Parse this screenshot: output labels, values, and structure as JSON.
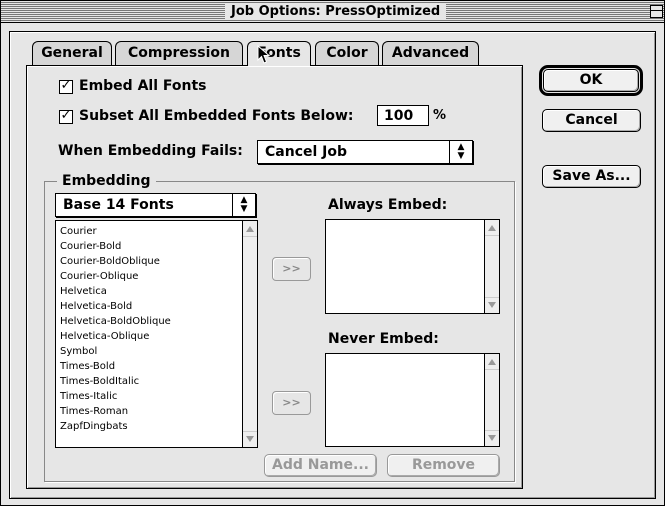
{
  "window": {
    "title": "Job Options: PressOptimized"
  },
  "tabs": [
    {
      "label": "General"
    },
    {
      "label": "Compression"
    },
    {
      "label": "Fonts"
    },
    {
      "label": "Color"
    },
    {
      "label": "Advanced"
    }
  ],
  "fonts_panel": {
    "embed_all": {
      "label": "Embed All Fonts",
      "checked": true
    },
    "subset": {
      "label": "Subset All Embedded Fonts Below:",
      "checked": true,
      "value": "100",
      "unit": "%"
    },
    "when_fails": {
      "label": "When Embedding Fails:",
      "selected": "Cancel Job"
    },
    "embedding": {
      "title": "Embedding",
      "source_selected": "Base 14 Fonts",
      "font_list": [
        "Courier",
        "Courier-Bold",
        "Courier-BoldOblique",
        "Courier-Oblique",
        "Helvetica",
        "Helvetica-Bold",
        "Helvetica-BoldOblique",
        "Helvetica-Oblique",
        "Symbol",
        "Times-Bold",
        "Times-BoldItalic",
        "Times-Italic",
        "Times-Roman",
        "ZapfDingbats"
      ],
      "move_button_label": ">>",
      "always_embed_label": "Always Embed:",
      "never_embed_label": "Never Embed:",
      "add_name_label": "Add Name...",
      "remove_label": "Remove"
    }
  },
  "buttons": {
    "ok": "OK",
    "cancel": "Cancel",
    "save_as": "Save As..."
  }
}
